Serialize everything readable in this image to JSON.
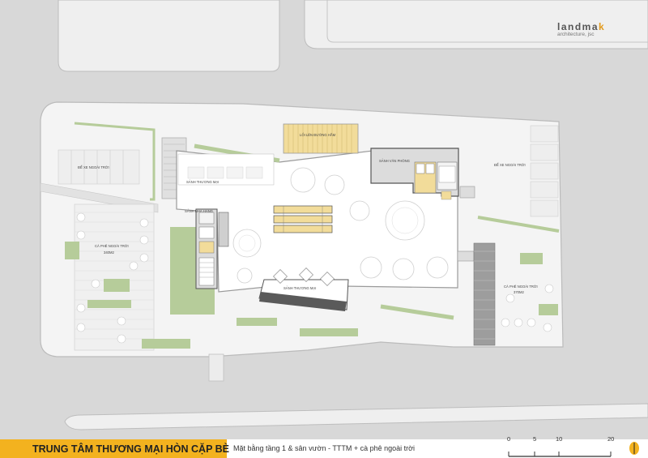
{
  "brand": {
    "logo_name_part1": "landma",
    "logo_name_part2": "k",
    "logo_sub": "architecture, jsc"
  },
  "labels": {
    "parking_left": "ĐỂ XE NGOÀI TRỜI",
    "cafe_left": "CÀ PHÊ NGOÀI TRỜI",
    "cafe_left_area": "340M2",
    "ramp": "LỐI LÊN ĐƯỜNG HẦM",
    "office_lobby": "SẢNH VĂN PHÒNG",
    "commercial_lobby_1": "SẢNH THƯƠNG MẠI",
    "house_lobby": "SẢNH NHÀ HÀNG",
    "commercial_lobby_2": "SẢNH THƯƠNG MẠI",
    "parking_right": "ĐỂ XE NGOÀI TRỜI",
    "cafe_right": "CÀ PHÊ NGOÀI TRỜI",
    "cafe_right_area": "370M2"
  },
  "footer": {
    "title": "TRUNG TÂM THƯƠNG MẠI HÒN CẶP BÈ",
    "subtitle": "Mặt bằng tầng 1 & sân vườn - TTTM + cà phê ngoài trời",
    "scale_ticks": [
      "0",
      "5",
      "10",
      "20"
    ],
    "accent": "#f3b21f"
  },
  "colors": {
    "road": "#d6d6d6",
    "block": "#efefef",
    "site": "#f6f6f6",
    "grass": "#b6cc9a",
    "building": "#ffffff",
    "stair": "#f2dc9a"
  }
}
